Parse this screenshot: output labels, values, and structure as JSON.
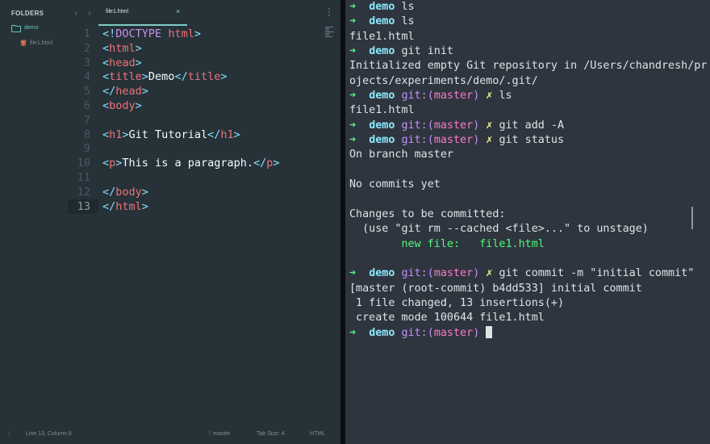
{
  "sidebar": {
    "header": "FOLDERS",
    "folder": "demo",
    "file": "file1.html"
  },
  "tabbar": {
    "back": "‹",
    "forward": "›",
    "tab_label": "file1.html",
    "close": "×"
  },
  "editor": {
    "lines": [
      {
        "n": "1",
        "tokens": [
          {
            "c": "br",
            "t": "<!"
          },
          {
            "c": "kw",
            "t": "DOCTYPE"
          },
          {
            "c": "tx",
            "t": " "
          },
          {
            "c": "tg",
            "t": "html"
          },
          {
            "c": "br",
            "t": ">"
          }
        ]
      },
      {
        "n": "2",
        "tokens": [
          {
            "c": "br",
            "t": "<"
          },
          {
            "c": "tg",
            "t": "html"
          },
          {
            "c": "br",
            "t": ">"
          }
        ]
      },
      {
        "n": "3",
        "tokens": [
          {
            "c": "br",
            "t": "<"
          },
          {
            "c": "tg",
            "t": "head"
          },
          {
            "c": "br",
            "t": ">"
          }
        ]
      },
      {
        "n": "4",
        "tokens": [
          {
            "c": "br",
            "t": "<"
          },
          {
            "c": "tg",
            "t": "title"
          },
          {
            "c": "br",
            "t": ">"
          },
          {
            "c": "tx",
            "t": "Demo"
          },
          {
            "c": "br",
            "t": "</"
          },
          {
            "c": "tg",
            "t": "title"
          },
          {
            "c": "br",
            "t": ">"
          }
        ]
      },
      {
        "n": "5",
        "tokens": [
          {
            "c": "br",
            "t": "</"
          },
          {
            "c": "tg",
            "t": "head"
          },
          {
            "c": "br",
            "t": ">"
          }
        ]
      },
      {
        "n": "6",
        "tokens": [
          {
            "c": "br",
            "t": "<"
          },
          {
            "c": "tg",
            "t": "body"
          },
          {
            "c": "br",
            "t": ">"
          }
        ]
      },
      {
        "n": "7",
        "tokens": []
      },
      {
        "n": "8",
        "tokens": [
          {
            "c": "br",
            "t": "<"
          },
          {
            "c": "tg",
            "t": "h1"
          },
          {
            "c": "br",
            "t": ">"
          },
          {
            "c": "tx",
            "t": "Git Tutorial"
          },
          {
            "c": "br",
            "t": "</"
          },
          {
            "c": "tg",
            "t": "h1"
          },
          {
            "c": "br",
            "t": ">"
          }
        ]
      },
      {
        "n": "9",
        "tokens": []
      },
      {
        "n": "10",
        "tokens": [
          {
            "c": "br",
            "t": "<"
          },
          {
            "c": "tg",
            "t": "p"
          },
          {
            "c": "br",
            "t": ">"
          },
          {
            "c": "tx",
            "t": "This is a paragraph."
          },
          {
            "c": "br",
            "t": "</"
          },
          {
            "c": "tg",
            "t": "p"
          },
          {
            "c": "br",
            "t": ">"
          }
        ]
      },
      {
        "n": "11",
        "tokens": []
      },
      {
        "n": "12",
        "tokens": [
          {
            "c": "br",
            "t": "</"
          },
          {
            "c": "tg",
            "t": "body"
          },
          {
            "c": "br",
            "t": ">"
          }
        ]
      },
      {
        "n": "13",
        "tokens": [
          {
            "c": "br",
            "t": "</"
          },
          {
            "c": "tg",
            "t": "html"
          },
          {
            "c": "br",
            "t": ">"
          }
        ]
      }
    ]
  },
  "statusbar": {
    "position": "Line 13, Column 8",
    "branch": "master",
    "tab_size": "Tab Size: 4",
    "syntax": "HTML"
  },
  "terminal": {
    "lines": [
      {
        "type": "prompt",
        "dir": "demo",
        "cmd": "ls"
      },
      {
        "type": "prompt",
        "dir": "demo",
        "cmd": "ls"
      },
      {
        "type": "out",
        "text": "file1.html"
      },
      {
        "type": "prompt",
        "dir": "demo",
        "cmd": "git init"
      },
      {
        "type": "out",
        "text": "Initialized empty Git repository in /Users/chandresh/pr"
      },
      {
        "type": "out",
        "text": "ojects/experiments/demo/.git/"
      },
      {
        "type": "git",
        "dir": "demo",
        "branch": "master",
        "cmd": "ls"
      },
      {
        "type": "out",
        "text": "file1.html"
      },
      {
        "type": "git",
        "dir": "demo",
        "branch": "master",
        "cmd": "git add -A"
      },
      {
        "type": "git",
        "dir": "demo",
        "branch": "master",
        "cmd": "git status"
      },
      {
        "type": "out",
        "text": "On branch master"
      },
      {
        "type": "out",
        "text": ""
      },
      {
        "type": "out",
        "text": "No commits yet"
      },
      {
        "type": "out",
        "text": ""
      },
      {
        "type": "out",
        "text": "Changes to be committed:"
      },
      {
        "type": "out",
        "text": "  (use \"git rm --cached <file>...\" to unstage)"
      },
      {
        "type": "green",
        "text": "        new file:   file1.html"
      },
      {
        "type": "out",
        "text": ""
      },
      {
        "type": "git",
        "dir": "demo",
        "branch": "master",
        "cmd": "git commit -m \"initial commit\""
      },
      {
        "type": "out",
        "text": "[master (root-commit) b4dd533] initial commit"
      },
      {
        "type": "out",
        "text": " 1 file changed, 13 insertions(+)"
      },
      {
        "type": "out",
        "text": " create mode 100644 file1.html"
      },
      {
        "type": "gitcursor",
        "dir": "demo",
        "branch": "master"
      }
    ]
  }
}
